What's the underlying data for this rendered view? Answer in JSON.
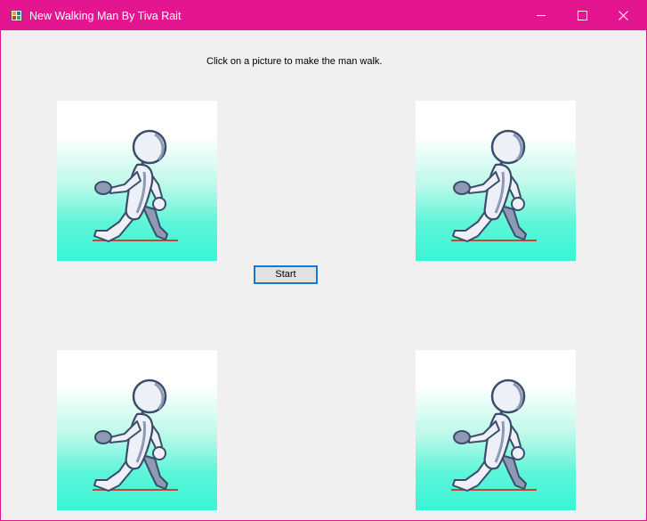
{
  "window": {
    "title": "New Walking Man By Tiva Rait",
    "title_bar_color": "#e3158f",
    "controls": [
      "minimize-icon",
      "maximize-icon",
      "close-icon"
    ]
  },
  "instruction": "Click on a picture to make the man walk.",
  "start_button": {
    "label": "Start"
  },
  "pictures": [
    {
      "name": "walking-man-picture-top-left",
      "icon": "walking-man"
    },
    {
      "name": "walking-man-picture-top-right",
      "icon": "walking-man"
    },
    {
      "name": "walking-man-picture-bottom-left",
      "icon": "walking-man"
    },
    {
      "name": "walking-man-picture-bottom-right",
      "icon": "walking-man"
    }
  ],
  "colors": {
    "picture_gradient_top": "#ffffff",
    "picture_gradient_bottom": "#38f5d6",
    "figure_fill": "#eef0f8",
    "figure_outline": "#3a4d6b",
    "ground_line": "#c0473a",
    "button_border": "#1579d3"
  }
}
